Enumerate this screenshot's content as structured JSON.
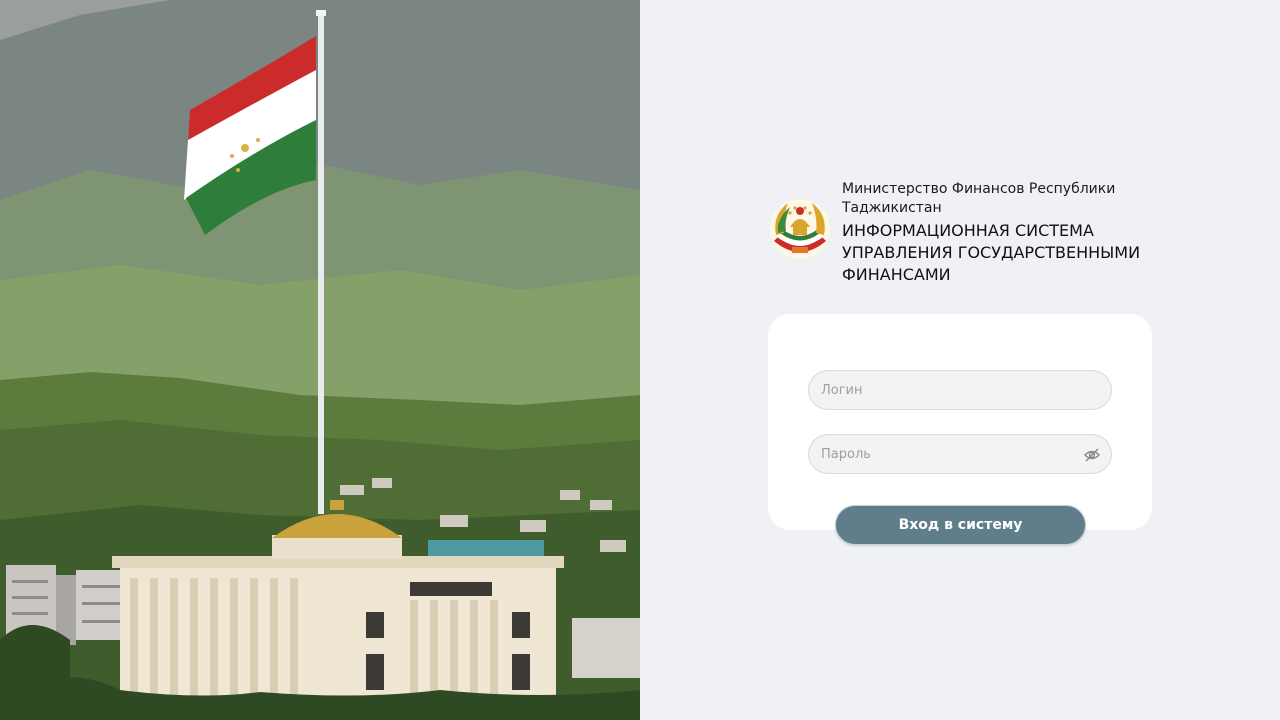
{
  "background_photo": {
    "icon": "tajik-flag-palace-photo"
  },
  "header": {
    "emblem_icon": "tajikistan-coat-of-arms-icon",
    "ministry": "Министерство Финансов Республики Таджикистан",
    "system_title": "ИНФОРМАЦИОННАЯ СИСТЕМА УПРАВЛЕНИЯ ГОСУДАРСТВЕННЫМИ ФИНАНСАМИ"
  },
  "form": {
    "login": {
      "placeholder": "Логин",
      "value": ""
    },
    "password": {
      "placeholder": "Пароль",
      "value": "",
      "toggle_icon": "eye-off-icon"
    },
    "submit_label": "Вход в систему"
  },
  "colors": {
    "page_bg": "#f0f1f5",
    "card_bg": "#ffffff",
    "input_bg": "#f3f3f3",
    "button_bg": "#607d8b",
    "flag_red": "#cc2b2b",
    "flag_white": "#ffffff",
    "flag_green": "#2f7d3a",
    "dome_gold": "#c9a23c"
  }
}
